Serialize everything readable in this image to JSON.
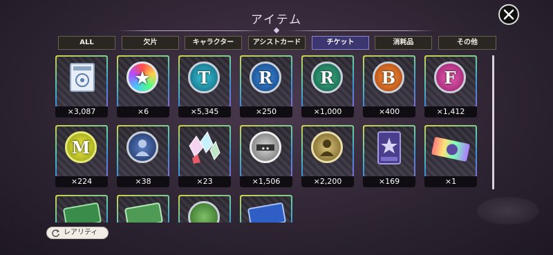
{
  "header": {
    "title": "アイテム",
    "close_icon": "close-icon"
  },
  "tabs": [
    {
      "label": "ALL",
      "active": false
    },
    {
      "label": "欠片",
      "active": false
    },
    {
      "label": "キャラクター",
      "active": false
    },
    {
      "label": "アシストカード",
      "active": false
    },
    {
      "label": "チケット",
      "active": true
    },
    {
      "label": "消耗品",
      "active": false
    },
    {
      "label": "その他",
      "active": false
    }
  ],
  "items": [
    {
      "icon": "document-ticket-icon",
      "count": "×3,087",
      "coin_text": ""
    },
    {
      "icon": "rainbow-star-coin-icon",
      "count": "×6",
      "coin_text": "★"
    },
    {
      "icon": "t-coin-icon",
      "count": "×5,345",
      "coin_text": "T"
    },
    {
      "icon": "r-coin-blue-icon",
      "count": "×250",
      "coin_text": "R"
    },
    {
      "icon": "r-coin-green-icon",
      "count": "×1,000",
      "coin_text": "R"
    },
    {
      "icon": "b-coin-icon",
      "count": "×400",
      "coin_text": "B"
    },
    {
      "icon": "f-coin-icon",
      "count": "×1,412",
      "coin_text": "F"
    },
    {
      "icon": "m-coin-icon",
      "count": "×224",
      "coin_text": "M"
    },
    {
      "icon": "character-coin-icon",
      "count": "×38",
      "coin_text": ""
    },
    {
      "icon": "crystal-shards-icon",
      "count": "×23",
      "coin_text": ""
    },
    {
      "icon": "silver-star-coin-icon",
      "count": "×1,506",
      "coin_text": ""
    },
    {
      "icon": "gold-character-coin-icon",
      "count": "×2,200",
      "coin_text": ""
    },
    {
      "icon": "star-card-icon",
      "count": "×169",
      "coin_text": ""
    },
    {
      "icon": "rainbow-ticket-icon",
      "count": "×1",
      "coin_text": ""
    },
    {
      "icon": "green-ticket-icon",
      "count": "",
      "coin_text": ""
    },
    {
      "icon": "green-ticket-icon",
      "count": "",
      "coin_text": ""
    },
    {
      "icon": "green-coin-icon",
      "count": "",
      "coin_text": ""
    },
    {
      "icon": "blue-ticket-icon",
      "count": "",
      "coin_text": ""
    }
  ],
  "footer": {
    "rarity_label": "レアリティ",
    "rarity_icon": "refresh-icon"
  },
  "colors": {
    "accent": "#3b3570",
    "card_border": "#58c8b2"
  }
}
